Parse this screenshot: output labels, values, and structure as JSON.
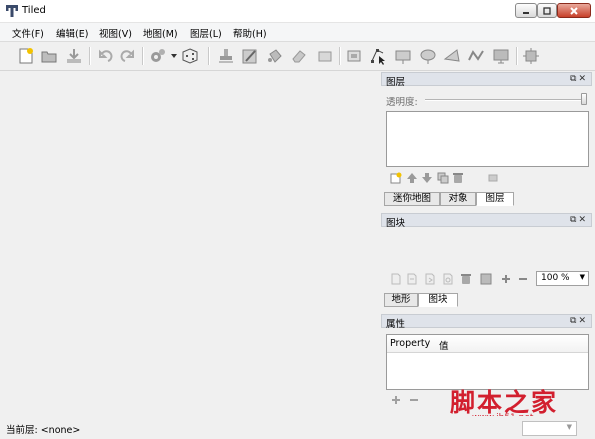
{
  "window": {
    "title": "Tiled"
  },
  "menu": [
    "文件(F)",
    "编辑(E)",
    "视图(V)",
    "地图(M)",
    "图层(L)",
    "帮助(H)"
  ],
  "layers_panel": {
    "title": "图层",
    "opacity_label": "透明度:",
    "opacity_value": 1.0,
    "tabs": [
      "迷你地图",
      "对象",
      "图层"
    ],
    "active_tab": "图层"
  },
  "tilesets_panel": {
    "title": "图块",
    "zoom": "100 %",
    "tabs": [
      "地形",
      "图块"
    ],
    "active_tab": "图块"
  },
  "properties_panel": {
    "title": "属性",
    "columns": [
      "Property",
      "值"
    ]
  },
  "status": {
    "label": "当前层: <none>"
  },
  "watermark": {
    "text": "脚本之家",
    "url": "www.jb51.net"
  },
  "colors": {
    "accent": "#2b6cc4",
    "watermark": "#d21f2e",
    "dock_title_bg": "#dfe3ea"
  }
}
